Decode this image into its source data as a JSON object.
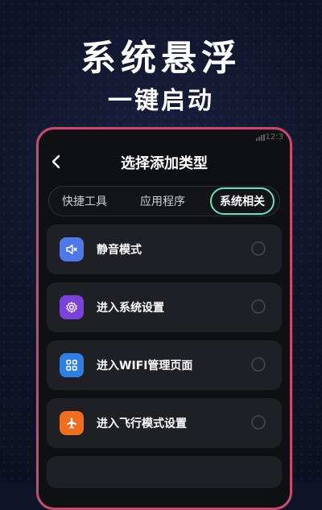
{
  "hero": {
    "title": "系统悬浮",
    "subtitle": "一键启动"
  },
  "phone": {
    "status_time": "12:3",
    "header": {
      "title": "选择添加类型"
    },
    "tabs": [
      {
        "label": "快捷工具",
        "active": false
      },
      {
        "label": "应用程序",
        "active": false
      },
      {
        "label": "系统相关",
        "active": true
      }
    ],
    "items": [
      {
        "label": "静音模式",
        "icon": "speaker-mute-icon",
        "color": "#4f79e8"
      },
      {
        "label": "进入系统设置",
        "icon": "gear-icon",
        "color": "#7b42d9"
      },
      {
        "label": "进入WIFI管理页面",
        "icon": "grid-icon",
        "color": "#2f7fe2"
      },
      {
        "label": "进入飞行模式设置",
        "icon": "airplane-icon",
        "color": "#f06e1f"
      }
    ]
  },
  "colors": {
    "frame": "#c94b6b",
    "active_tab_outline": "#6fe0b8"
  }
}
